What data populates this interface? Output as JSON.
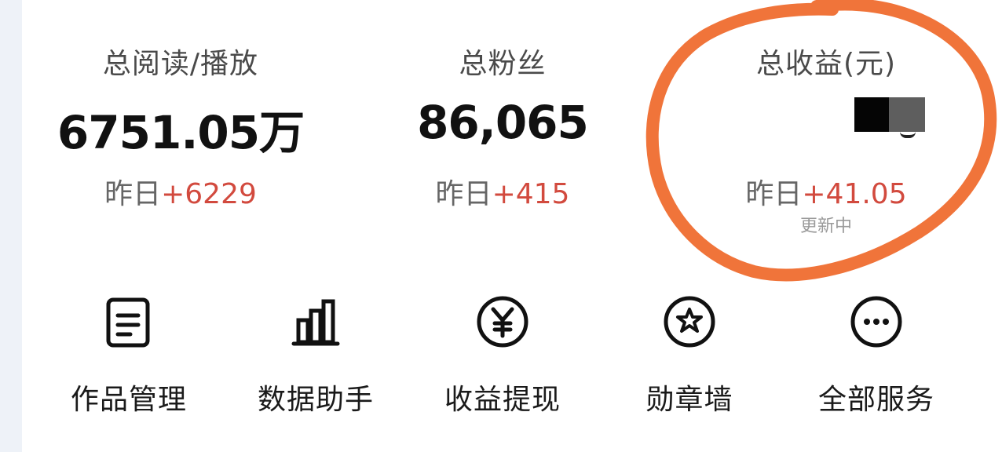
{
  "stats": [
    {
      "label": "总阅读/播放",
      "value": "6751.05万",
      "delta_prefix": "昨日",
      "delta": "+6229"
    },
    {
      "label": "总粉丝",
      "value": "86,065",
      "delta_prefix": "昨日",
      "delta": "+415"
    },
    {
      "label": "总收益(元)",
      "value": "",
      "delta_prefix": "昨日",
      "delta": "+41.05",
      "note": "更新中"
    }
  ],
  "services": [
    {
      "label": "作品管理",
      "icon": "document-icon"
    },
    {
      "label": "数据助手",
      "icon": "bar-chart-icon"
    },
    {
      "label": "收益提现",
      "icon": "yuan-coin-icon"
    },
    {
      "label": "勋章墙",
      "icon": "star-badge-icon"
    },
    {
      "label": "全部服务",
      "icon": "more-icon"
    }
  ],
  "colors": {
    "positive_delta": "#d24a3e",
    "annotation_circle": "#f0743a",
    "background": "#eef2f8",
    "card": "#ffffff"
  }
}
